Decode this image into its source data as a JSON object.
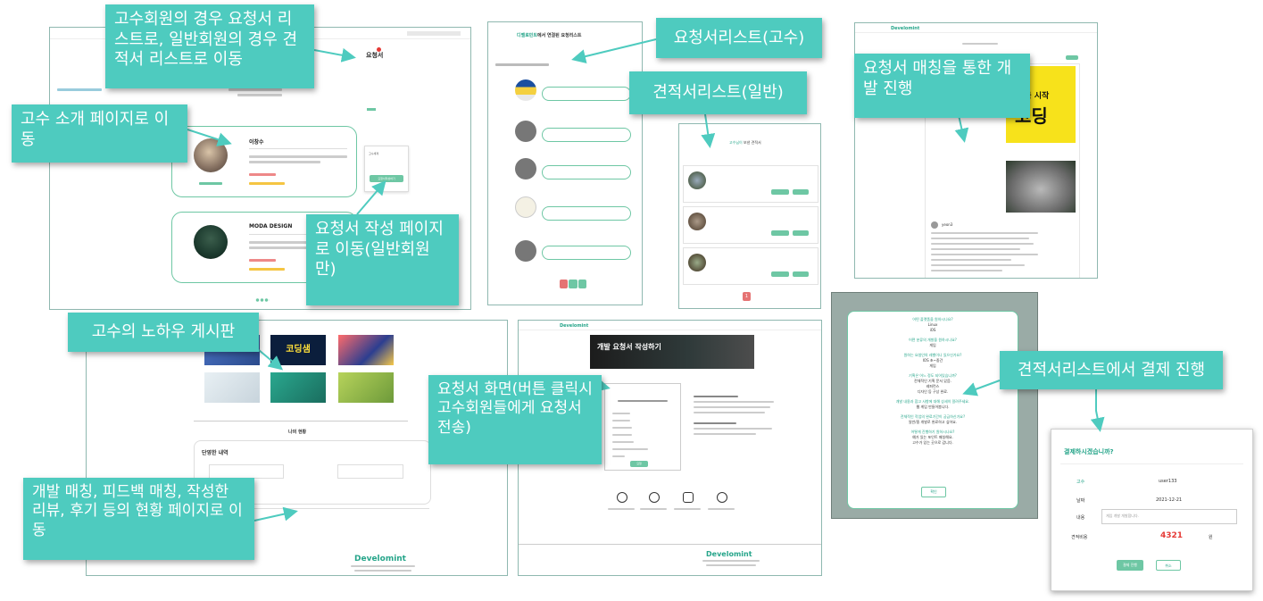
{
  "callouts": {
    "request_list_move": "고수회원의 경우 요청서 리스트로, 일반회원의 경우 견적서 리스트로 이동",
    "expert_intro": "고수 소개 페이지로 이동",
    "request_write": "요청서 작성 페이지로 이동(일반회원만)",
    "request_list_expert": "요청서리스트(고수)",
    "estimate_list_general": "견적서리스트(일반)",
    "dev_progress": "요청서 매칭을 통한 개발 진행",
    "knowhow_board": "고수의 노하우 게시판",
    "request_screen": "요청서 화면(버튼 클릭시 고수회원들에게 요청서 전송)",
    "status_pages": "개발 매칭, 피드백 매칭, 작성한 리뷰, 후기 등의 현황 페이지로 이동",
    "payment_from_estimate": "견적서리스트에서 결제 진행"
  },
  "screen1": {
    "request_link": "요청서",
    "expert_name_1": "이창수",
    "expert_name_2": "MODA DESIGN",
    "side_box_title": "고수세계",
    "side_box_button": "요청서작성하기"
  },
  "screen2": {
    "title_highlight": "디벨로민트",
    "title_rest": "에서 연결된 요청리스트"
  },
  "screen3": {
    "title_highlight": "고수님이",
    "title_rest": " 보낸 견적서",
    "page": "1"
  },
  "screen4": {
    "brand": "Develomint",
    "promo_text": "코딩",
    "promo_top": "지금 시작",
    "user_id": "yeon3"
  },
  "screen5": {
    "promo": "코딩샘",
    "section_title": "나의 현황",
    "box_title": "단영한 내역"
  },
  "screen6": {
    "brand": "Develomint",
    "hero_title": "개발 요청서 작성하기",
    "submit_label": "요청",
    "footer_brand": "Develomint"
  },
  "screen7": {
    "q1": "어떤 플랫폼을 원하시나요?",
    "a1": "Linux",
    "a1b": "iOS",
    "q2": "어떤 분류의 개발을 원하시나요?",
    "a2": "게임",
    "q3": "원하는 요청인의 레벨이나 있으신가요?",
    "a3": "IOS 초~중간",
    "a3b": "게임",
    "q4": "기획은 어느 정도 되어있습니까?",
    "a4": "전체적인 기획 문서 있음.",
    "a4b": "레퍼런스",
    "a4c": "디자인 등 구상 완료.",
    "q5": "개발 내용과 참고 사항에 대해 상세히 알려주세요.",
    "a5": "웹 게임 만들어봅니다.",
    "q6": "전체적인 작업의 완료기간이 궁금하신가요?",
    "a6": "일반/중 개발로 완료하고 싶어요.",
    "q7": "어떻게 진행하기 원하시나요?",
    "a7": "예가 있는 포인트 매칭해요.",
    "a7b": "고수가 있는 곳으로 갑니다.",
    "confirm": "확인"
  },
  "payment": {
    "title": "결제하시겠습니까?",
    "row1_label": "고수",
    "row1_value": "user133",
    "row2_label": "날짜",
    "row2_value": "2021-12-21",
    "row3_label": "내용",
    "row3_value": "게임 개발 개발합니다.",
    "row4_label": "견적비용",
    "row4_value": "4321",
    "row4_unit": "원",
    "pay_button": "결제 진행",
    "cancel_button": "취소"
  },
  "colors": {
    "callout": "#4ecbbf",
    "mint": "#6ec7a4",
    "price": "#e53935"
  }
}
